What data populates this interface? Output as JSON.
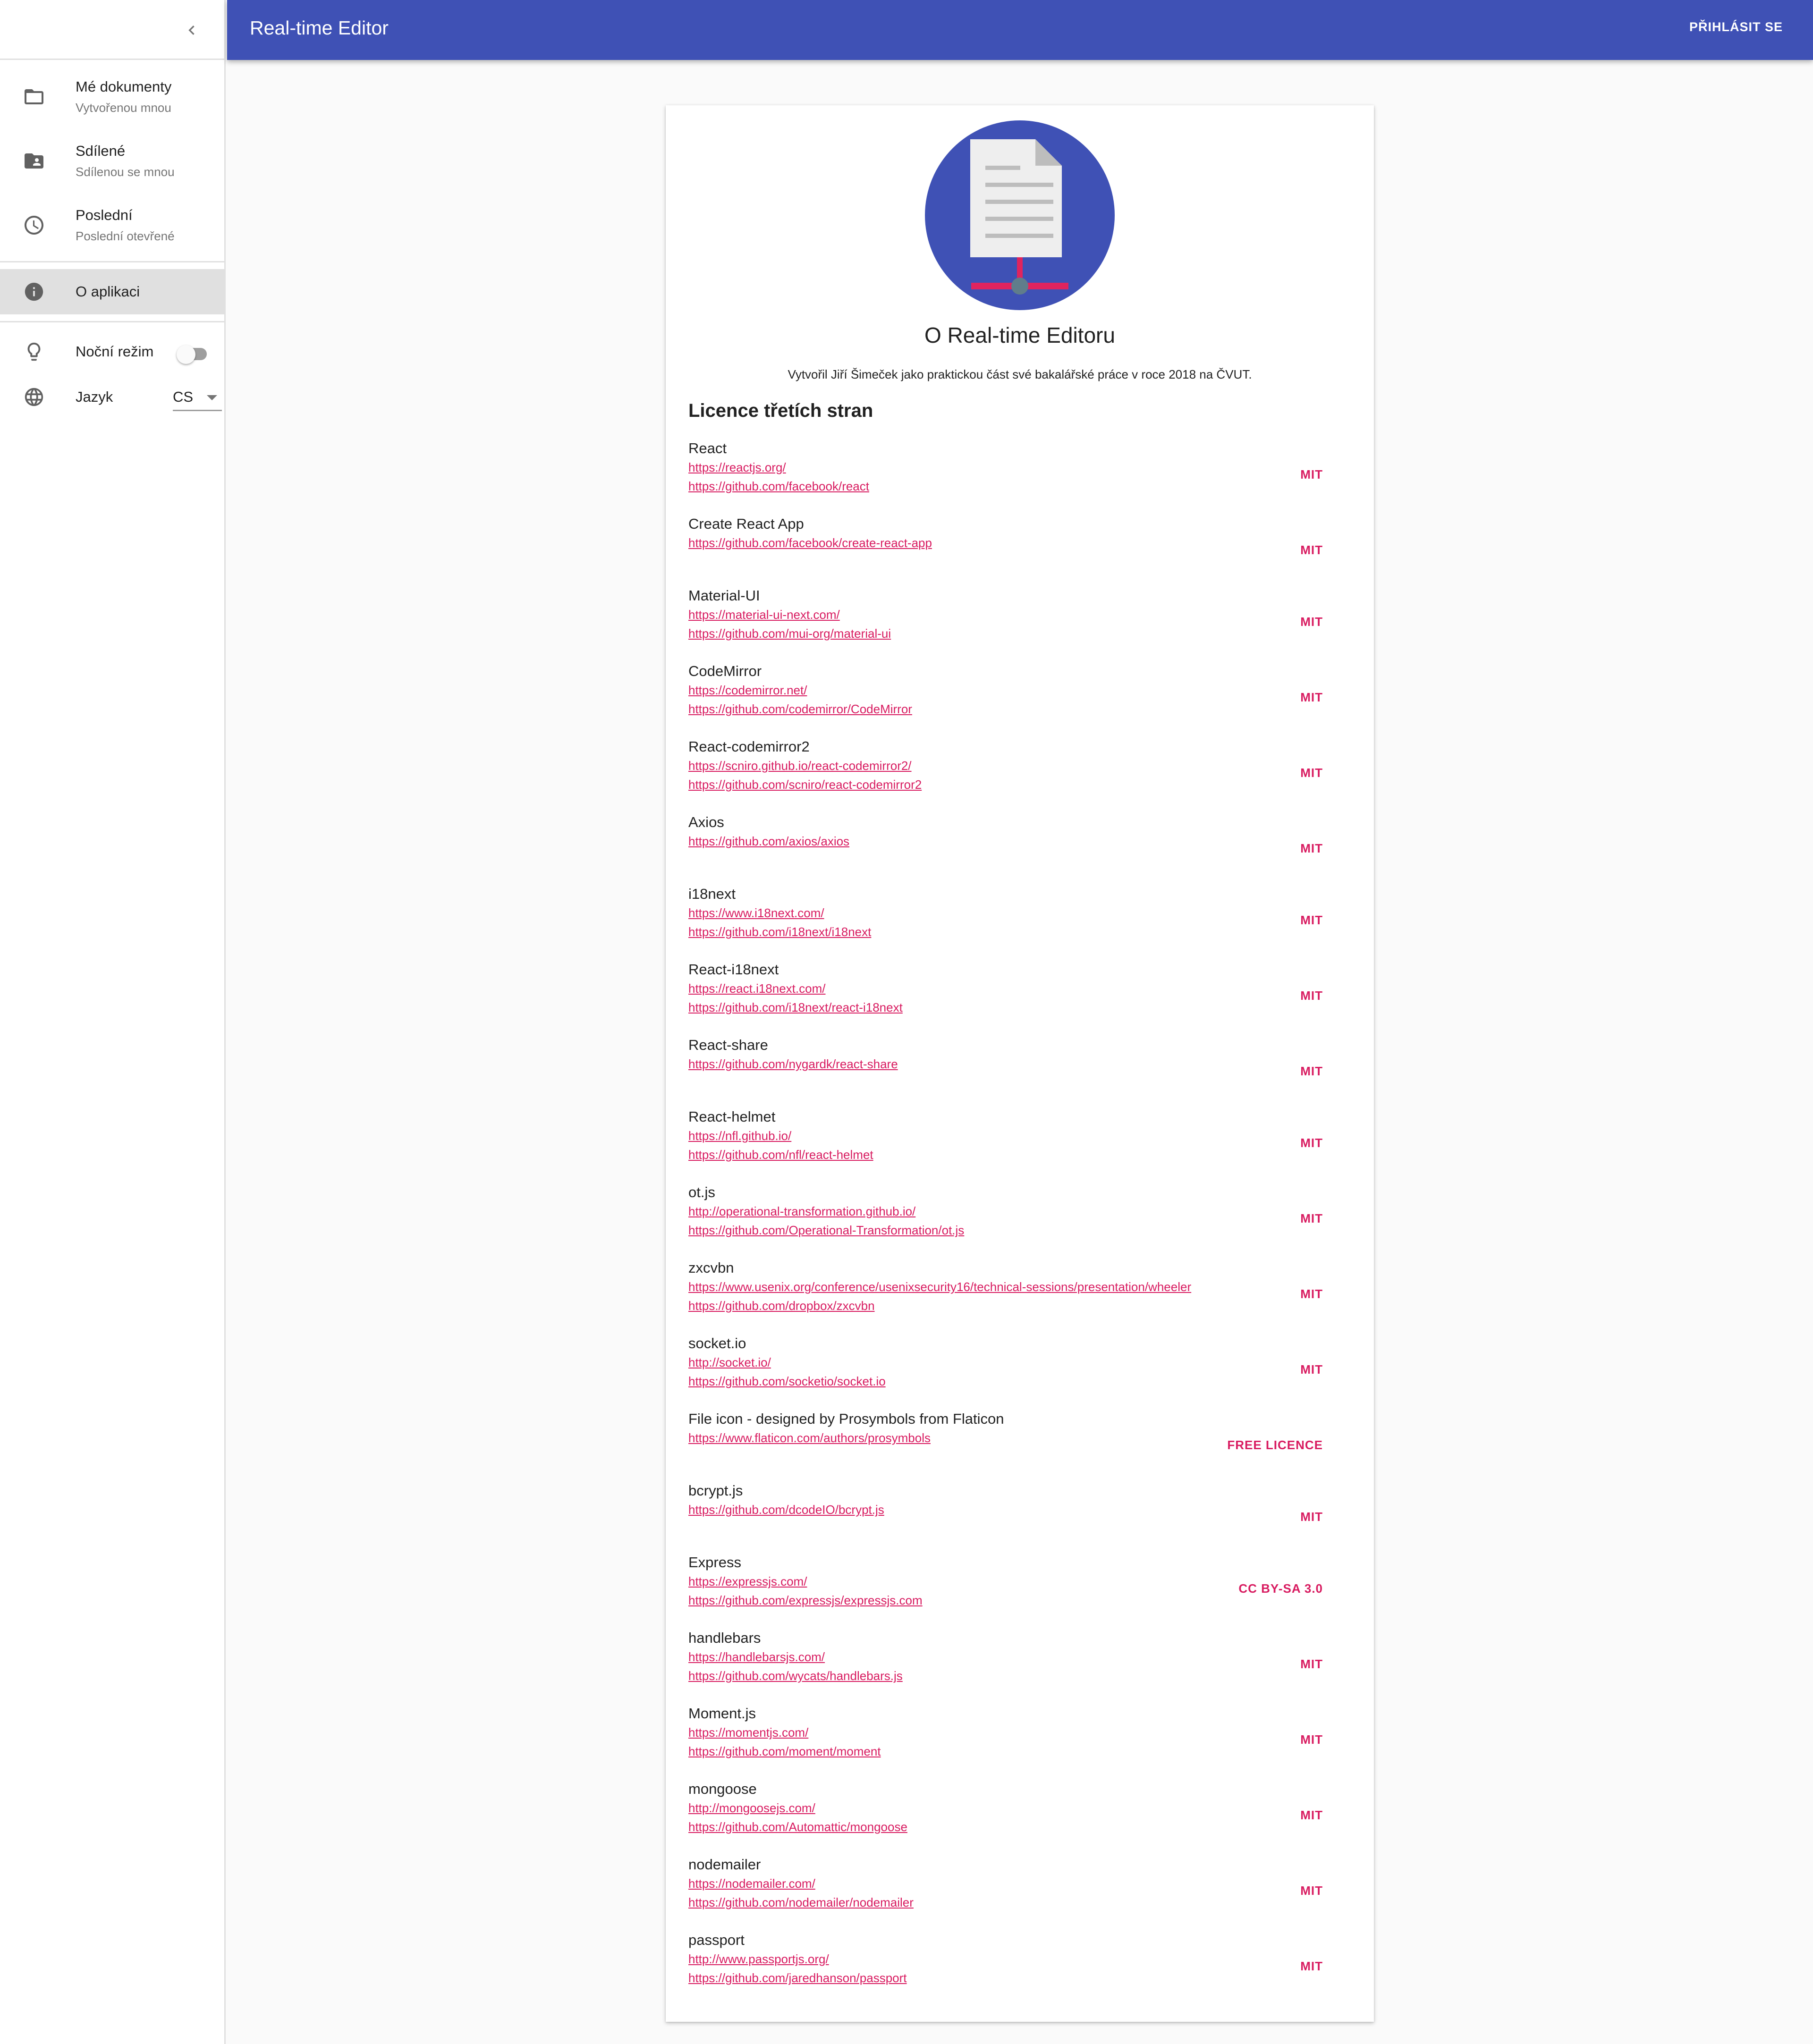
{
  "appbar": {
    "title": "Real-time Editor",
    "login_label": "PŘIHLÁSIT SE"
  },
  "sidebar": {
    "items": [
      {
        "label": "Mé dokumenty",
        "sub": "Vytvořenou mnou",
        "icon": "folder-icon"
      },
      {
        "label": "Sdílené",
        "sub": "Sdílenou se mnou",
        "icon": "shared-folder-icon"
      },
      {
        "label": "Poslední",
        "sub": "Poslední otevřené",
        "icon": "clock-icon"
      }
    ],
    "about": {
      "label": "O aplikaci",
      "icon": "info-icon"
    },
    "night_mode": {
      "label": "Noční režim",
      "on": false
    },
    "language": {
      "label": "Jazyk",
      "value": "CS"
    }
  },
  "about": {
    "title": "O Real-time Editoru",
    "subtitle": "Vytvořil Jiří Šimeček jako praktickou část své bakalářské práce v roce 2018 na ČVUT.",
    "licences_title": "Licence třetích stran",
    "licences": [
      {
        "name": "React",
        "links": [
          "https://reactjs.org/",
          "https://github.com/facebook/react"
        ],
        "licence": "MIT"
      },
      {
        "name": "Create React App",
        "links": [
          "https://github.com/facebook/create-react-app"
        ],
        "licence": "MIT"
      },
      {
        "name": "Material-UI",
        "links": [
          "https://material-ui-next.com/",
          "https://github.com/mui-org/material-ui"
        ],
        "licence": "MIT"
      },
      {
        "name": "CodeMirror",
        "links": [
          "https://codemirror.net/",
          "https://github.com/codemirror/CodeMirror"
        ],
        "licence": "MIT"
      },
      {
        "name": "React-codemirror2",
        "links": [
          "https://scniro.github.io/react-codemirror2/",
          "https://github.com/scniro/react-codemirror2"
        ],
        "licence": "MIT"
      },
      {
        "name": "Axios",
        "links": [
          "https://github.com/axios/axios"
        ],
        "licence": "MIT"
      },
      {
        "name": "i18next",
        "links": [
          "https://www.i18next.com/",
          "https://github.com/i18next/i18next"
        ],
        "licence": "MIT"
      },
      {
        "name": "React-i18next",
        "links": [
          "https://react.i18next.com/",
          "https://github.com/i18next/react-i18next"
        ],
        "licence": "MIT"
      },
      {
        "name": "React-share",
        "links": [
          "https://github.com/nygardk/react-share"
        ],
        "licence": "MIT"
      },
      {
        "name": "React-helmet",
        "links": [
          "https://nfl.github.io/",
          "https://github.com/nfl/react-helmet"
        ],
        "licence": "MIT"
      },
      {
        "name": "ot.js",
        "links": [
          "http://operational-transformation.github.io/",
          "https://github.com/Operational-Transformation/ot.js"
        ],
        "licence": "MIT"
      },
      {
        "name": "zxcvbn",
        "links": [
          "https://www.usenix.org/conference/usenixsecurity16/technical-sessions/presentation/wheeler",
          "https://github.com/dropbox/zxcvbn"
        ],
        "licence": "MIT"
      },
      {
        "name": "socket.io",
        "links": [
          "http://socket.io/",
          "https://github.com/socketio/socket.io"
        ],
        "licence": "MIT"
      },
      {
        "name": "File icon - designed by Prosymbols from Flaticon",
        "links": [
          "https://www.flaticon.com/authors/prosymbols"
        ],
        "licence": "FREE LICENCE"
      },
      {
        "name": "bcrypt.js",
        "links": [
          "https://github.com/dcodeIO/bcrypt.js"
        ],
        "licence": "MIT"
      },
      {
        "name": "Express",
        "links": [
          "https://expressjs.com/",
          "https://github.com/expressjs/expressjs.com"
        ],
        "licence": "CC BY-SA 3.0"
      },
      {
        "name": "handlebars",
        "links": [
          "https://handlebarsjs.com/",
          "https://github.com/wycats/handlebars.js"
        ],
        "licence": "MIT"
      },
      {
        "name": "Moment.js",
        "links": [
          "https://momentjs.com/",
          "https://github.com/moment/moment"
        ],
        "licence": "MIT"
      },
      {
        "name": "mongoose",
        "links": [
          "http://mongoosejs.com/",
          "https://github.com/Automattic/mongoose"
        ],
        "licence": "MIT"
      },
      {
        "name": "nodemailer",
        "links": [
          "https://nodemailer.com/",
          "https://github.com/nodemailer/nodemailer"
        ],
        "licence": "MIT"
      },
      {
        "name": "passport",
        "links": [
          "http://www.passportjs.org/",
          "https://github.com/jaredhanson/passport"
        ],
        "licence": "MIT"
      }
    ]
  },
  "colors": {
    "primary": "#3f51b5",
    "accent": "#d81b60",
    "logo_bar": "#e0245e",
    "logo_node": "#607d8b"
  }
}
